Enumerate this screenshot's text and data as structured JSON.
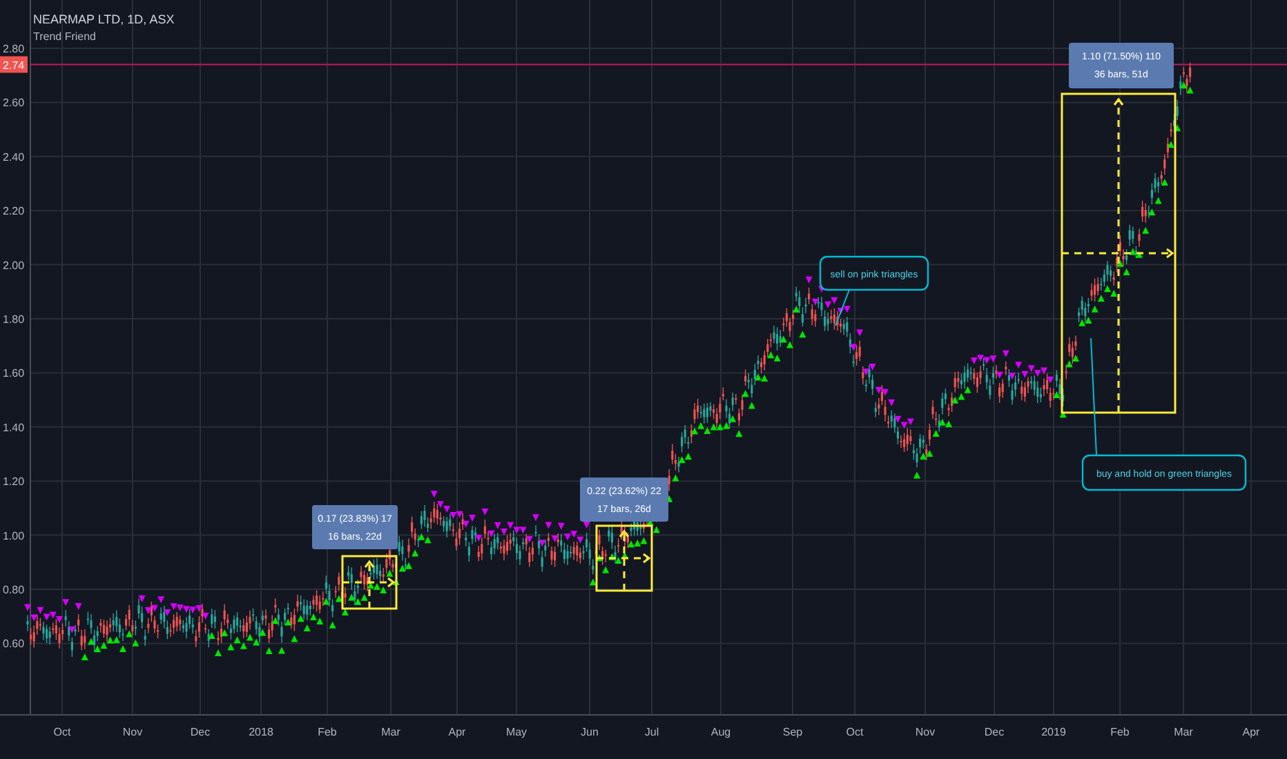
{
  "header": {
    "symbol": "NEARMAP LTD, 1D, ASX",
    "indicator": "Trend Friend"
  },
  "price_axis": [
    "2.80",
    "2.60",
    "2.40",
    "2.20",
    "2.00",
    "1.80",
    "1.60",
    "1.40",
    "1.20",
    "1.00",
    "0.80",
    "0.60"
  ],
  "current_price": "2.74",
  "time_axis": [
    "Oct",
    "Nov",
    "Dec",
    "2018",
    "Feb",
    "Mar",
    "Apr",
    "May",
    "Jun",
    "Jul",
    "Aug",
    "Sep",
    "Oct",
    "Nov",
    "Dec",
    "2019",
    "Feb",
    "Mar",
    "Apr"
  ],
  "measurements": [
    {
      "lines": [
        "0.17 (23.83%) 17",
        "16 bars, 22d"
      ]
    },
    {
      "lines": [
        "0.22 (23.62%) 22",
        "17 bars, 26d"
      ]
    },
    {
      "lines": [
        "1.10 (71.50%) 110",
        "36 bars, 51d"
      ]
    }
  ],
  "notes": [
    {
      "text": "sell on pink triangles"
    },
    {
      "text": "buy and hold on green triangles"
    }
  ]
}
